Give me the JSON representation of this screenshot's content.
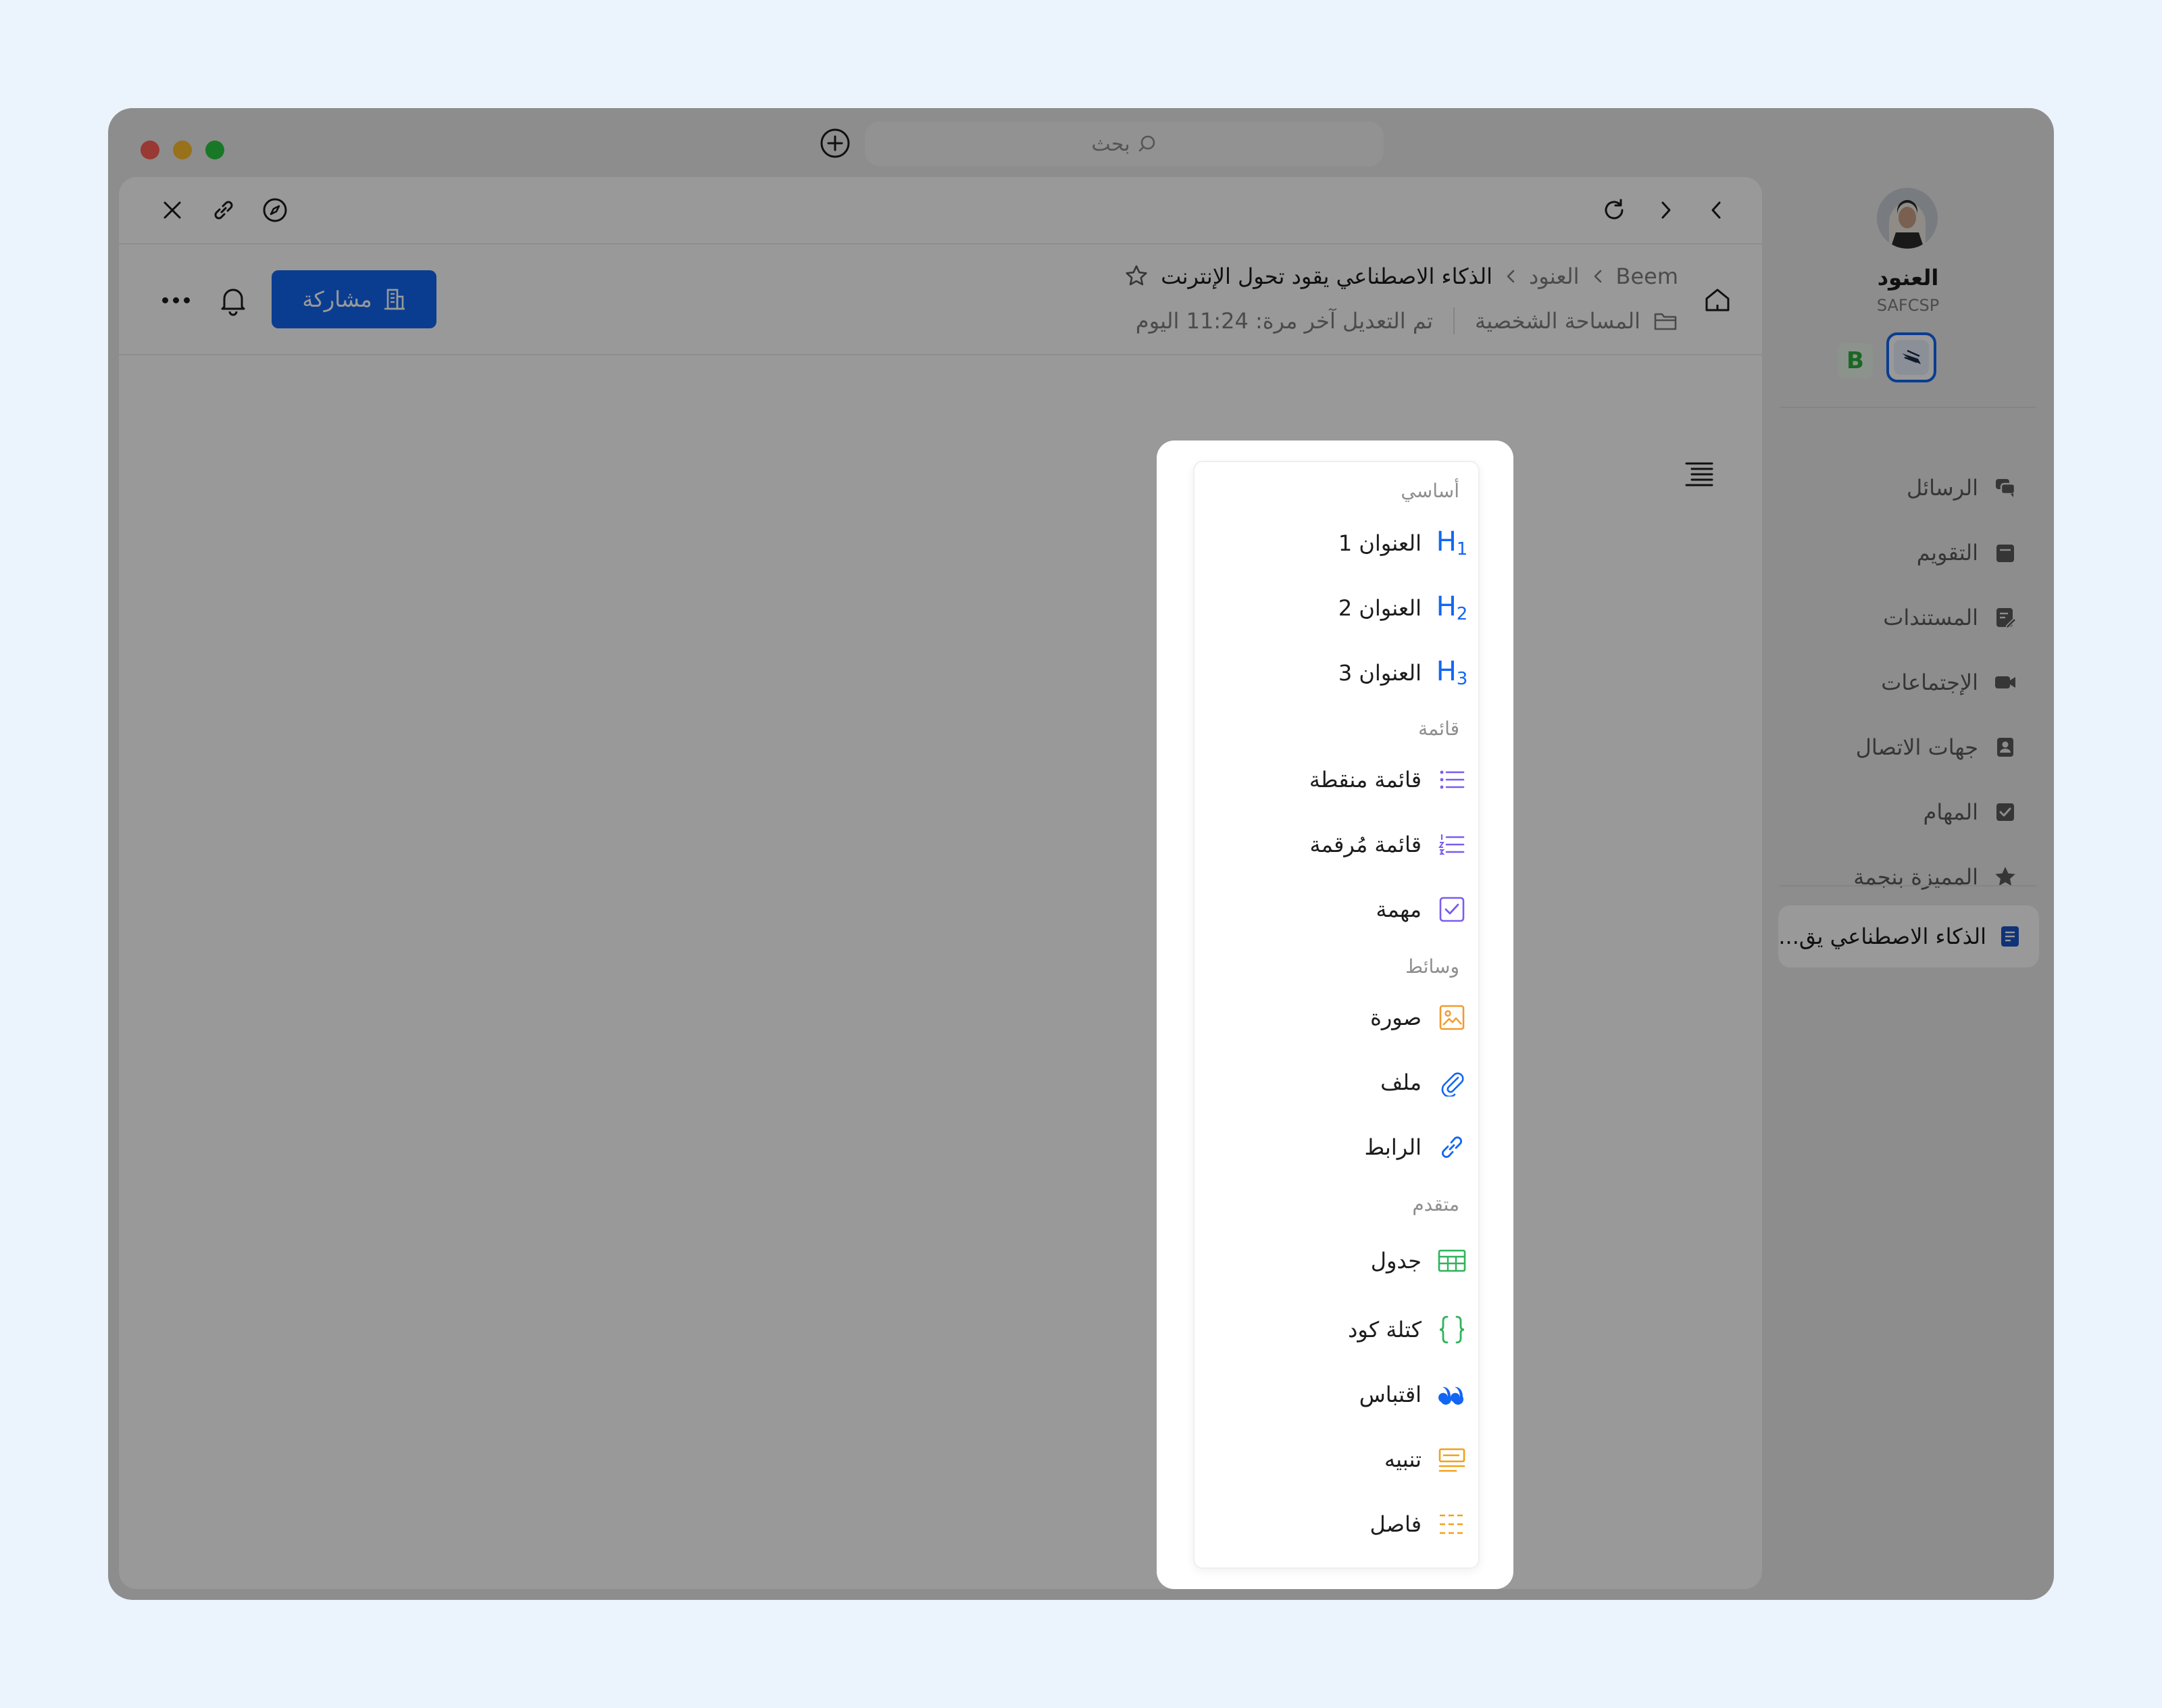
{
  "window": {
    "search_placeholder": "بحث"
  },
  "sidebar": {
    "user_name": "العنود",
    "user_org": "SAFCSP",
    "workspace_badge": "B",
    "nav_items": [
      {
        "label": "الرسائل",
        "icon": "messages-icon"
      },
      {
        "label": "التقويم",
        "icon": "calendar-icon"
      },
      {
        "label": "المستندات",
        "icon": "documents-icon"
      },
      {
        "label": "الإجتماعات",
        "icon": "meetings-icon"
      },
      {
        "label": "جهات الاتصال",
        "icon": "contacts-icon"
      },
      {
        "label": "المهام",
        "icon": "tasks-icon"
      },
      {
        "label": "المميزة بنجمة",
        "icon": "star-icon"
      }
    ],
    "recent_doc": "الذكاء الاصطناعي يق..."
  },
  "document": {
    "breadcrumb": [
      "Beem",
      "العنود"
    ],
    "title": "الذكاء الاصطناعي يقود تحول الإنترنت",
    "location": "المساحة الشخصية",
    "last_modified": "تم التعديل آخر مرة: 11:24 اليوم",
    "share_label": "مشاركة",
    "slash": "/"
  },
  "slash_menu": {
    "sections": {
      "basic": "أساسي",
      "list": "قائمة",
      "media": "وسائط",
      "advanced": "متقدم"
    },
    "items": {
      "h1": "العنوان 1",
      "h2": "العنوان 2",
      "h3": "العنوان 3",
      "bullet": "قائمة منقطة",
      "numbered": "قائمة مُرقمة",
      "task": "مهمة",
      "image": "صورة",
      "file": "ملف",
      "link": "الرابط",
      "table": "جدول",
      "code": "كتلة كود",
      "quote": "اقتباس",
      "callout": "تنبيه",
      "divider": "فاصل"
    },
    "heading_glyphs": {
      "h": "H",
      "n1": "1",
      "n2": "2",
      "n3": "3"
    },
    "colors": {
      "heading": "#1266f1",
      "list": "#7b5cf0",
      "media": "#f29a2e",
      "table": "#2fb35a",
      "quote": "#1266f1",
      "callout": "#f2a11a"
    }
  }
}
